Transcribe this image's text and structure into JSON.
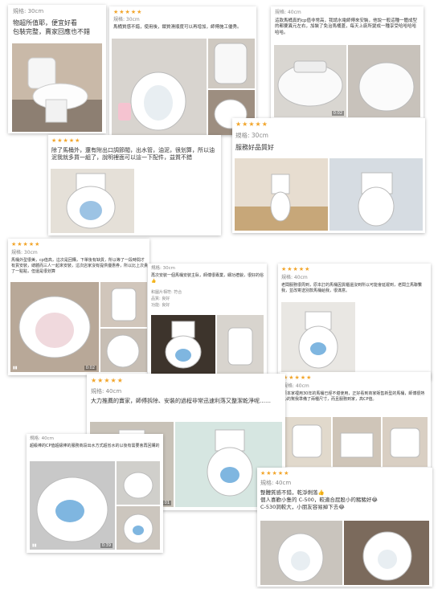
{
  "reviews": [
    {
      "spec": "規格: 30cm",
      "text": "物超所值耶，便宜好看\n包裝完整，賣家回應也不錯"
    },
    {
      "stars": "★★★★★",
      "spec": "規格: 30cm",
      "text": "馬桶質感不錯，使用後，鎖質滑順度可以再增加，師傅施工優秀。"
    },
    {
      "spec": "規格: 40cm",
      "text": "這款馬桶真的cp值非常高，我請水電師傅來安裝，他說一般這種一體成型的都要異元左右，加裝了免治馬桶蓋，每天上廁所變成一種享受哈哈哈哈哈哈。",
      "video_time": "0:02"
    },
    {
      "stars": "★★★★★",
      "spec": "規格: 30cm",
      "text": "服務好品質好"
    },
    {
      "stars": "★★★★★",
      "text": "除了馬桶外，還有附出口調節閥，出水管，油泥，很划算，所以油泥我就多買一組了，說明裡面可以這一下配件，益質不錯"
    },
    {
      "stars": "★★★★★",
      "spec": "規格: 30cm",
      "text": "馬桶外型很美，cp值高，這次是回購，下單後有缺貨，所以等了一段時間才有貨安裝，總體而三人一起來安裝，這次店家沒有提供優惠券，所以比上次貴了一點點，但還是很划算",
      "video_time": "0:02"
    },
    {
      "spec": "規格: 30cm",
      "text": "再次安裝一個馬桶安裝主臥，師傅很專業，細功禮貌，很好的俗👍",
      "attrs": [
        "和圖片相符: 符合",
        "品質: 良好",
        "功能: 良好"
      ]
    },
    {
      "stars": "★★★★★",
      "spec": "規格: 40cm",
      "text": "老闆服務很周到，原本訂的馬桶因貨櫃還沒到所以可能會延遲到，老闆立馬聯繫我，並改寄送別款馬桶給我，很滿意。"
    },
    {
      "stars": "★★★★★",
      "spec": "規格: 40cm",
      "text": "原本家裡用30年的馬桶已經不堪使用，正好看到商家販售新型的馬桶，師傅很熱心的幫我準備了兩種尺寸，而且服務到家，高CP值。"
    },
    {
      "stars": "★★★★★",
      "spec": "規格: 40cm",
      "text": "大力推薦的賣家，師傅拆除、安裝的過程非常迅速利落又整潔乾淨呢……",
      "video_time": "0:01"
    },
    {
      "spec": "規格: 40cm",
      "text": "超級棒的CP值超級棒的服務商段出水方式超省水的以後有需要會再回購的",
      "video_time": "0:39"
    },
    {
      "stars": "★★★★★",
      "spec": "規格: 40cm",
      "text": "整體質感不錯，乾淨俐落👍\n個人喜歡小隻的 C-500，較適合屁股小的豬豬好😂\nC-530洞較大，小朋友容易掉下去😂"
    }
  ],
  "colors": {
    "star": "#f2a52a",
    "tile": "#e7ddd0",
    "toilet": "#ffffff",
    "floor": "#8d7f72"
  }
}
